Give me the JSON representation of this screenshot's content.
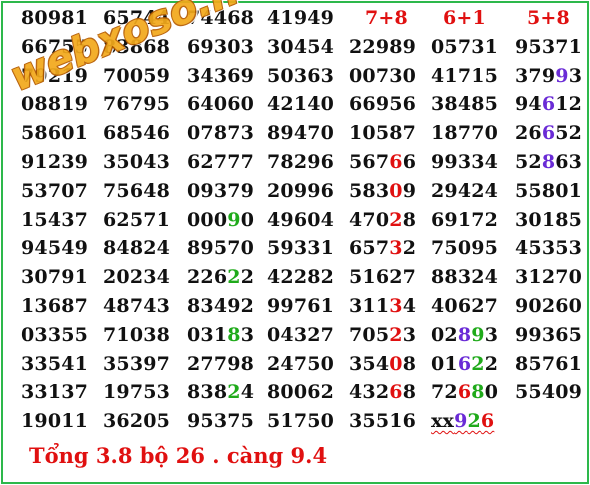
{
  "headers": [
    "7+8",
    "6+1",
    "5+8"
  ],
  "rows": [
    [
      [
        "80981"
      ],
      [
        "65744"
      ],
      [
        "74468"
      ],
      [
        "41949"
      ],
      null,
      null,
      null
    ],
    [
      [
        "66755"
      ],
      [
        "83868"
      ],
      [
        "69303"
      ],
      [
        "30454"
      ],
      [
        "22989"
      ],
      [
        "05731"
      ],
      [
        "95371"
      ]
    ],
    [
      [
        "79219"
      ],
      [
        "70059"
      ],
      [
        "34369"
      ],
      [
        "50363"
      ],
      [
        "00730"
      ],
      [
        "41715"
      ],
      [
        [
          "379",
          "n"
        ],
        [
          "9",
          "purple"
        ],
        [
          "3",
          "n"
        ]
      ]
    ],
    [
      [
        "08819"
      ],
      [
        "76795"
      ],
      [
        "64060"
      ],
      [
        "42140"
      ],
      [
        "66956"
      ],
      [
        "38485"
      ],
      [
        [
          "94",
          "n"
        ],
        [
          "6",
          "purple"
        ],
        [
          "12",
          "n"
        ]
      ]
    ],
    [
      [
        "58601"
      ],
      [
        "68546"
      ],
      [
        "07873"
      ],
      [
        "89470"
      ],
      [
        "10587"
      ],
      [
        "18770"
      ],
      [
        [
          "26",
          "n"
        ],
        [
          "6",
          "purple"
        ],
        [
          "52",
          "n"
        ]
      ]
    ],
    [
      [
        "91239"
      ],
      [
        "35043"
      ],
      [
        "62777"
      ],
      [
        "78296"
      ],
      [
        [
          "567",
          "n"
        ],
        [
          "6",
          "red"
        ],
        [
          "6",
          "n"
        ]
      ],
      [
        "99334"
      ],
      [
        [
          "52",
          "n"
        ],
        [
          "8",
          "purple"
        ],
        [
          "63",
          "n"
        ]
      ]
    ],
    [
      [
        "53707"
      ],
      [
        "75648"
      ],
      [
        "09379"
      ],
      [
        "20996"
      ],
      [
        [
          "583",
          "n"
        ],
        [
          "0",
          "red"
        ],
        [
          "9",
          "n"
        ]
      ],
      [
        "29424"
      ],
      [
        "55801"
      ]
    ],
    [
      [
        "15437"
      ],
      [
        "62571"
      ],
      [
        [
          "000",
          "n"
        ],
        [
          "9",
          "green"
        ],
        [
          "0",
          "n"
        ]
      ],
      [
        "49604"
      ],
      [
        [
          "470",
          "n"
        ],
        [
          "2",
          "red"
        ],
        [
          "8",
          "n"
        ]
      ],
      [
        "69172"
      ],
      [
        "30185"
      ]
    ],
    [
      [
        "94549"
      ],
      [
        "84824"
      ],
      [
        "89570"
      ],
      [
        "59331"
      ],
      [
        [
          "657",
          "n"
        ],
        [
          "3",
          "red"
        ],
        [
          "2",
          "n"
        ]
      ],
      [
        "75095"
      ],
      [
        "45353"
      ]
    ],
    [
      [
        "30791"
      ],
      [
        "20234"
      ],
      [
        [
          "226",
          "n"
        ],
        [
          "2",
          "green"
        ],
        [
          "2",
          "n"
        ]
      ],
      [
        "42282"
      ],
      [
        "51627"
      ],
      [
        "88324"
      ],
      [
        "31270"
      ]
    ],
    [
      [
        "13687"
      ],
      [
        "48743"
      ],
      [
        "83492"
      ],
      [
        "99761"
      ],
      [
        [
          "311",
          "n"
        ],
        [
          "3",
          "red"
        ],
        [
          "4",
          "n"
        ]
      ],
      [
        "40627"
      ],
      [
        "90260"
      ]
    ],
    [
      [
        "03355"
      ],
      [
        "71038"
      ],
      [
        [
          "031",
          "n"
        ],
        [
          "8",
          "green"
        ],
        [
          "3",
          "n"
        ]
      ],
      [
        "04327"
      ],
      [
        [
          "705",
          "n"
        ],
        [
          "2",
          "red"
        ],
        [
          "3",
          "n"
        ]
      ],
      [
        [
          "02",
          "n"
        ],
        [
          "8",
          "purple"
        ],
        [
          "9",
          "green"
        ],
        [
          "3",
          "n"
        ]
      ],
      [
        "99365"
      ]
    ],
    [
      [
        "33541"
      ],
      [
        "35397"
      ],
      [
        "27798"
      ],
      [
        "24750"
      ],
      [
        [
          "354",
          "n"
        ],
        [
          "0",
          "red"
        ],
        [
          "8",
          "n"
        ]
      ],
      [
        [
          "01",
          "n"
        ],
        [
          "6",
          "purple"
        ],
        [
          "2",
          "green"
        ],
        [
          "2",
          "n"
        ]
      ],
      [
        "85761"
      ]
    ],
    [
      [
        "33137"
      ],
      [
        "19753"
      ],
      [
        [
          "838",
          "n"
        ],
        [
          "2",
          "green"
        ],
        [
          "4",
          "n"
        ]
      ],
      [
        "80062"
      ],
      [
        [
          "432",
          "n"
        ],
        [
          "6",
          "red"
        ],
        [
          "8",
          "n"
        ]
      ],
      [
        [
          "72",
          "n"
        ],
        [
          "6",
          "red"
        ],
        [
          "8",
          "green"
        ],
        [
          "0",
          "n"
        ]
      ],
      [
        "55409"
      ]
    ],
    [
      [
        "19011"
      ],
      [
        "36205"
      ],
      [
        "95375"
      ],
      [
        "51750"
      ],
      [
        "35516"
      ],
      [
        [
          "xx",
          "n"
        ],
        [
          "9",
          "purple"
        ],
        [
          "2",
          "green"
        ],
        [
          "6",
          "red"
        ]
      ],
      null
    ]
  ],
  "footer": "Tổng 3.8 bộ 26 . càng 9.4",
  "watermark": "webxoso.net",
  "colors": {
    "border": "#2db84b",
    "red": "#e01010",
    "green": "#1faa1a",
    "purple": "#6a2bd6",
    "watermark": "#f2a91b"
  }
}
